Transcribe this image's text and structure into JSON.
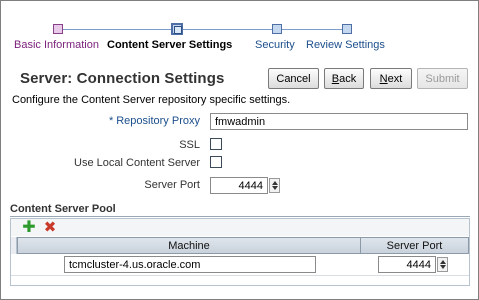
{
  "train": {
    "stops": [
      {
        "label": "Basic Information",
        "state": "visited"
      },
      {
        "label": "Content Server Settings",
        "state": "current"
      },
      {
        "label": "Security",
        "state": "future"
      },
      {
        "label": "Review Settings",
        "state": "future"
      }
    ]
  },
  "header": {
    "title": "Server: Connection Settings",
    "buttons": {
      "cancel": "Cancel",
      "back_access": "B",
      "back_rest": "ack",
      "next_access": "N",
      "next_rest": "ext",
      "submit": "Submit"
    }
  },
  "instructions": "Configure the Content Server repository specific settings.",
  "form": {
    "repository_proxy": {
      "required_mark": "*",
      "label": "Repository Proxy",
      "value": "fmwadmin"
    },
    "ssl": {
      "label": "SSL",
      "checked": false
    },
    "use_local": {
      "label": "Use Local Content Server",
      "checked": false
    },
    "server_port": {
      "label": "Server Port",
      "value": "4444"
    }
  },
  "pool": {
    "title": "Content Server Pool",
    "toolbar": {
      "add_icon": "add-icon",
      "remove_icon": "remove-icon"
    },
    "columns": [
      "Machine",
      "Server Port"
    ],
    "rows": [
      {
        "machine": "tcmcluster-4.us.oracle.com",
        "server_port": "4444"
      }
    ]
  },
  "colors": {
    "visited": "#7a1f7a",
    "future_link": "#1c4f8c",
    "add": "#2e9a2e",
    "remove": "#c93a2a"
  }
}
